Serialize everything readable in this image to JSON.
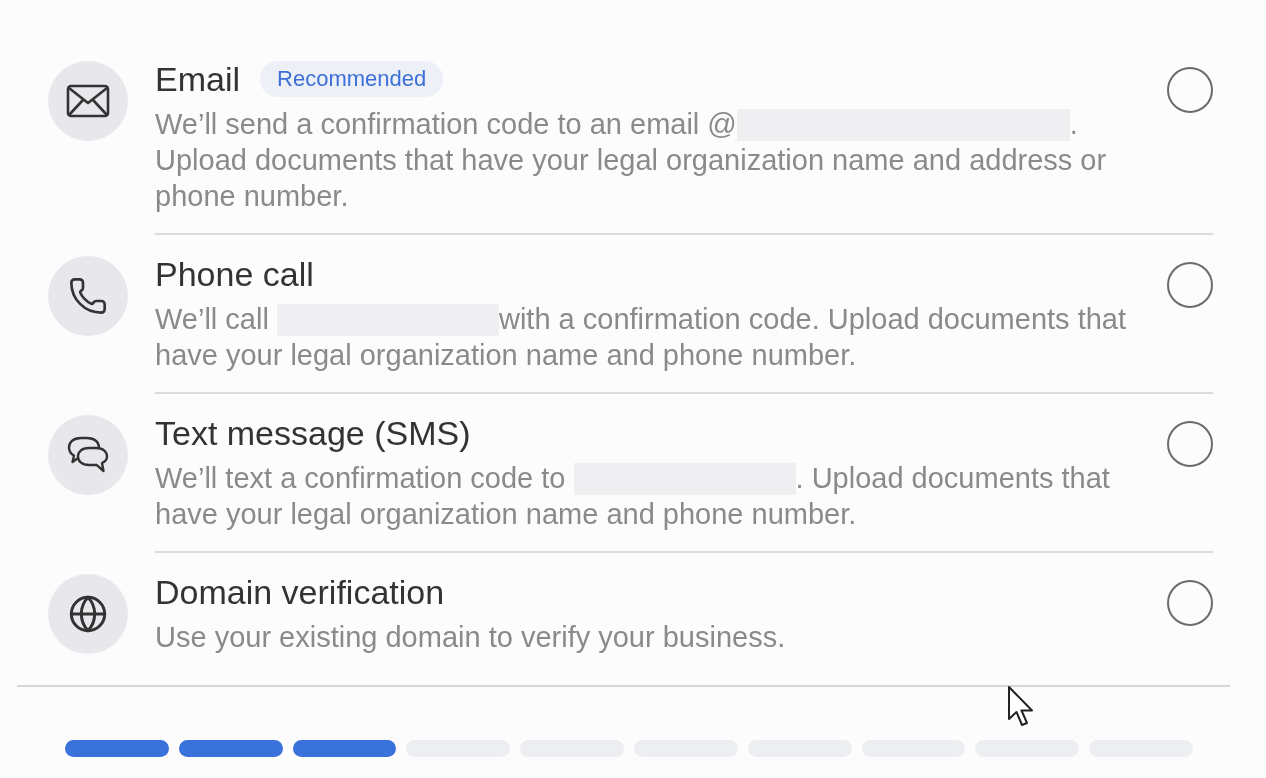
{
  "options": [
    {
      "kind": "email",
      "title": "Email",
      "badge": "Recommended",
      "description": [
        {
          "kind": "text",
          "text": "We’ll send a confirmation code to an email @"
        },
        {
          "kind": "redacted_email"
        },
        {
          "kind": "text",
          "text": ". Upload documents that have your legal organization name and address or phone number."
        }
      ],
      "selected": false
    },
    {
      "kind": "phone",
      "title": "Phone call",
      "description": [
        {
          "kind": "text",
          "text": "We’ll call "
        },
        {
          "kind": "redacted_phone"
        },
        {
          "kind": "text",
          "text": "with a confirmation code. Upload documents that have your legal organization name and phone number."
        }
      ],
      "selected": false
    },
    {
      "kind": "sms",
      "title": "Text message (SMS)",
      "description": [
        {
          "kind": "text",
          "text": "We’ll text a confirmation code to "
        },
        {
          "kind": "redacted_phone"
        },
        {
          "kind": "text",
          "text": ". Upload documents that have your legal organization name and phone number."
        }
      ],
      "selected": false
    },
    {
      "kind": "domain",
      "title": "Domain verification",
      "description": [
        {
          "kind": "text",
          "text": "Use your existing domain to verify your business."
        }
      ],
      "selected": false
    }
  ],
  "progress": {
    "segments": [
      {
        "filled": true
      },
      {
        "filled": true
      },
      {
        "filled": true
      },
      {
        "filled": false
      },
      {
        "filled": false
      },
      {
        "filled": false
      },
      {
        "filled": false
      },
      {
        "filled": false
      },
      {
        "filled": false
      },
      {
        "filled": false
      }
    ]
  }
}
